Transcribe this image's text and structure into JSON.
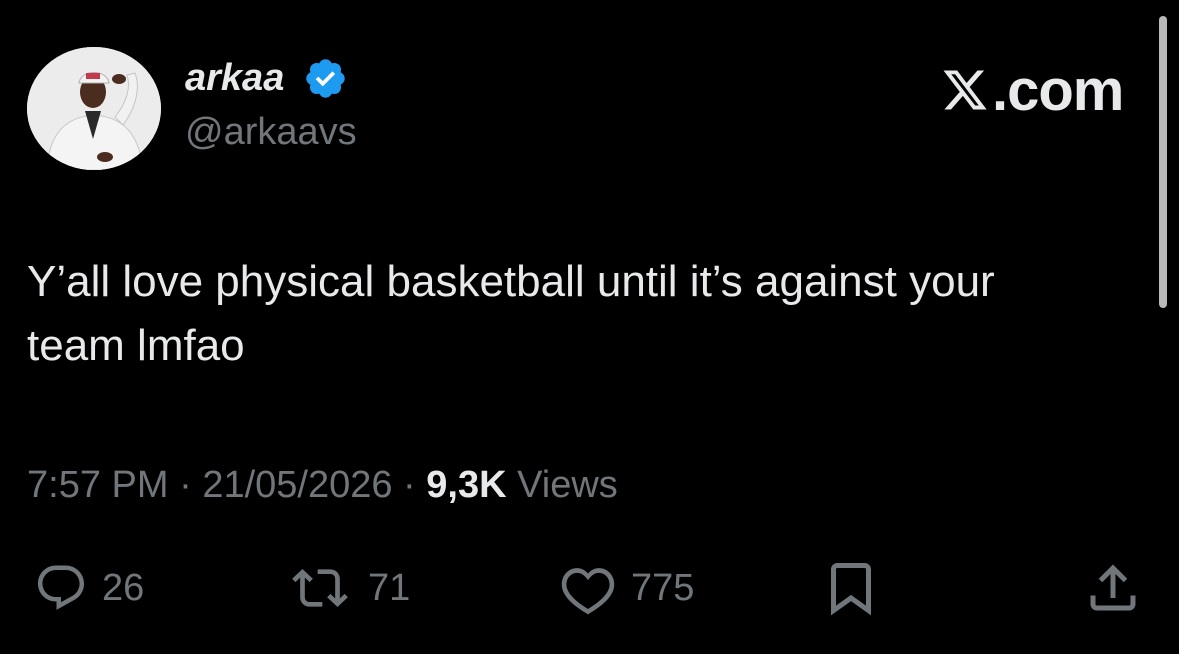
{
  "author": {
    "display_name": "arkaa",
    "handle": "@arkaavs",
    "verified": true,
    "verified_color": "#1d9bf0"
  },
  "brand": {
    "label": ".com"
  },
  "tweet": {
    "text": "Y’all love physical basketball until it’s against your team lmfao"
  },
  "meta": {
    "time": "7:57 PM",
    "separator": " · ",
    "date": "21/05/2026",
    "views_count": "9,3K",
    "views_label": " Views"
  },
  "actions": {
    "replies": {
      "icon": "reply-icon",
      "count": "26"
    },
    "reposts": {
      "icon": "repost-icon",
      "count": "71"
    },
    "likes": {
      "icon": "heart-icon",
      "count": "775"
    },
    "bookmark": {
      "icon": "bookmark-icon"
    },
    "share": {
      "icon": "share-icon"
    }
  },
  "colors": {
    "background": "#000000",
    "primary_text": "#e7e9ea",
    "secondary_text": "#71767b"
  }
}
